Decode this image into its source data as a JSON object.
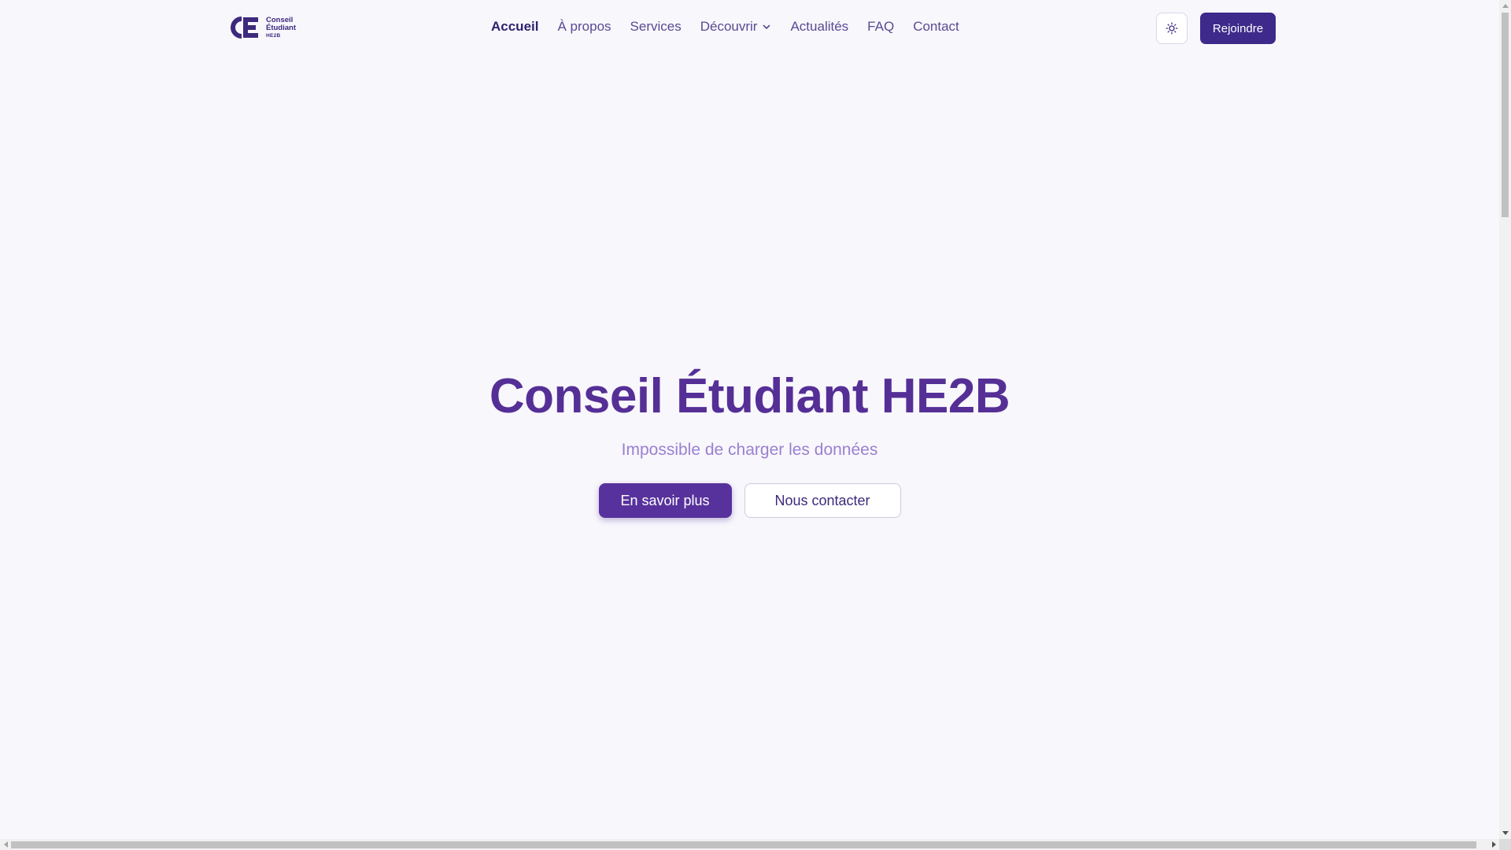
{
  "logo": {
    "line1": "Conseil",
    "line2": "Étudiant",
    "line3": "HE2B",
    "mark_icon": "ce-logo-icon"
  },
  "nav": {
    "items": [
      {
        "label": "Accueil",
        "active": true
      },
      {
        "label": "À propos"
      },
      {
        "label": "Services"
      },
      {
        "label": "Découvrir",
        "icon": "chevron-down-icon"
      },
      {
        "label": "Actualités"
      },
      {
        "label": "FAQ"
      },
      {
        "label": "Contact"
      }
    ]
  },
  "header": {
    "theme_icon": "sun-icon",
    "join_label": "Rejoindre"
  },
  "hero": {
    "title": "Conseil Étudiant HE2B",
    "subtitle": "Impossible de charger les données",
    "primary_label": "En savoir plus",
    "secondary_label": "Nous contacter"
  },
  "colors": {
    "background": "#f8f7fc",
    "brand": "#3d2a8a",
    "title": "#552f96",
    "subtitle": "#9a80cf"
  }
}
